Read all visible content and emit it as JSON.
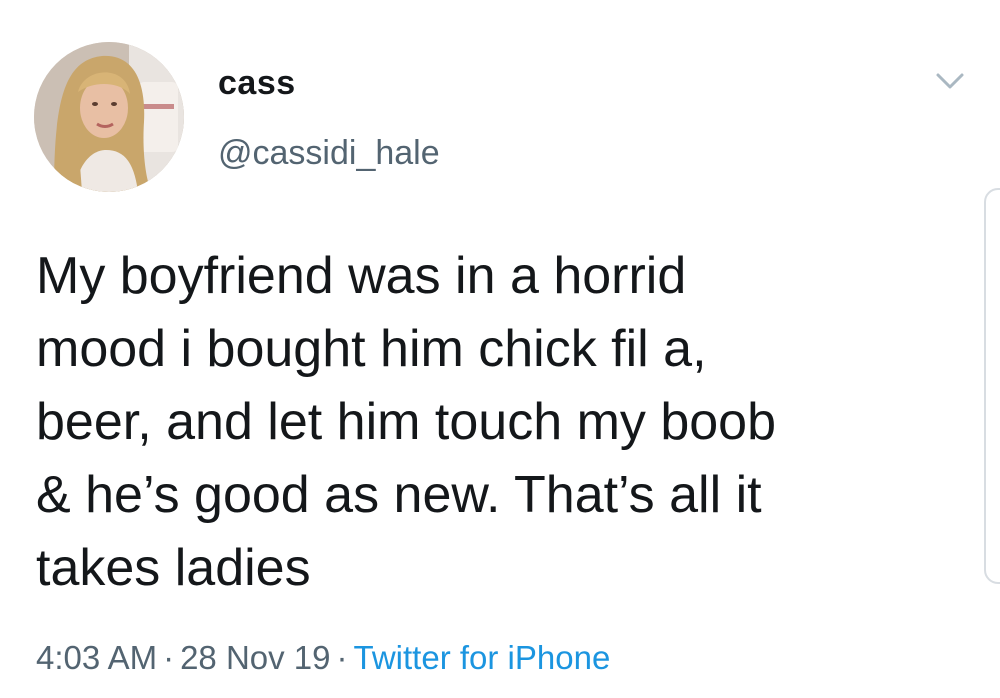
{
  "tweet": {
    "author": {
      "display_name": "cass",
      "handle": "@cassidi_hale",
      "avatar_icon": "user-photo-avatar"
    },
    "menu_icon": "chevron-down-icon",
    "text_lines": [
      "My boyfriend was in a horrid",
      "mood i bought him chick fil a,",
      "beer, and let him touch my boob",
      "& he’s good as new. That’s all it",
      "takes ladies"
    ],
    "meta": {
      "time": "4:03 AM",
      "separator": "·",
      "date": "28 Nov 19",
      "source": "Twitter for iPhone"
    }
  },
  "colors": {
    "text": "#14171a",
    "secondary_text": "#536471",
    "link": "#1b95e0",
    "background": "#ffffff"
  }
}
